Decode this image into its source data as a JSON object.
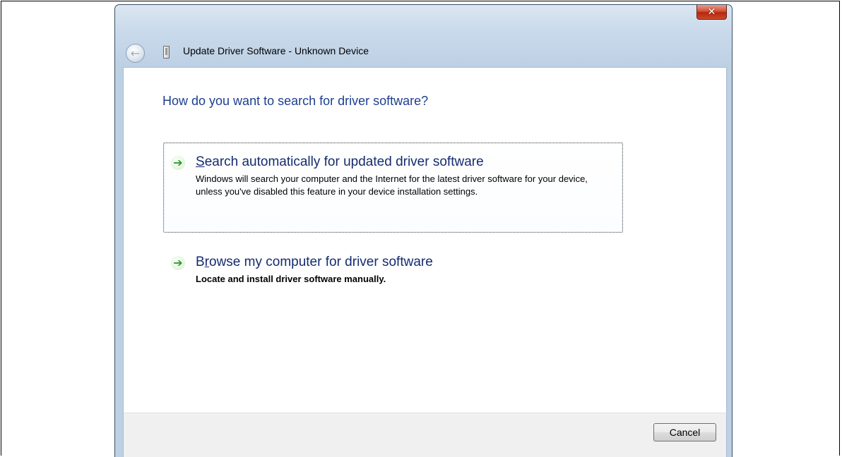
{
  "window": {
    "title": "Update Driver Software - Unknown Device",
    "close_glyph": "✕"
  },
  "header": {
    "back_glyph": "←"
  },
  "content": {
    "question": "How do you want to search for driver software?",
    "options": [
      {
        "title_first": "S",
        "title_rest": "earch automatically for updated driver software",
        "description": "Windows will search your computer and the Internet for the latest driver software for your device, unless you've disabled this feature in your device installation settings.",
        "arrow_glyph": "➔",
        "icon": "green-arrow-icon"
      },
      {
        "title_first": "B",
        "title_underlined": "r",
        "title_rest": "owse my computer for driver software",
        "description": "Locate and install driver software manually.",
        "arrow_glyph": "➔",
        "icon": "green-arrow-icon"
      }
    ]
  },
  "footer": {
    "cancel_label": "Cancel"
  },
  "colors": {
    "heading": "#1e3f8f",
    "option_title": "#152c6e",
    "arrow": "#2d9a2d",
    "close_button": "#c84a2a"
  }
}
